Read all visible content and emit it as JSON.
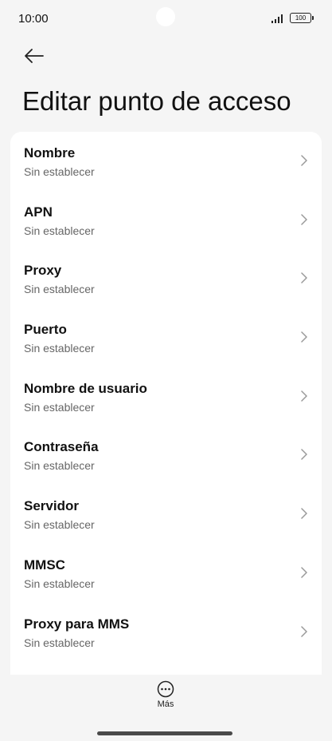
{
  "status_bar": {
    "time": "10:00",
    "battery": "100",
    "icons": [
      "signal-icon",
      "battery-icon"
    ]
  },
  "header": {
    "back_icon": "arrow-left-icon",
    "title": "Editar punto de acceso"
  },
  "settings": {
    "items": [
      {
        "label": "Nombre",
        "value": "Sin establecer"
      },
      {
        "label": "APN",
        "value": "Sin establecer"
      },
      {
        "label": "Proxy",
        "value": "Sin establecer"
      },
      {
        "label": "Puerto",
        "value": "Sin establecer"
      },
      {
        "label": "Nombre de usuario",
        "value": "Sin establecer"
      },
      {
        "label": "Contraseña",
        "value": "Sin establecer"
      },
      {
        "label": "Servidor",
        "value": "Sin establecer"
      },
      {
        "label": "MMSC",
        "value": "Sin establecer"
      },
      {
        "label": "Proxy para MMS",
        "value": "Sin establecer"
      }
    ]
  },
  "bottom_bar": {
    "more_label": "Más",
    "more_icon": "more-horizontal-icon"
  },
  "colors": {
    "background": "#f5f5f5",
    "card": "#ffffff",
    "text_primary": "#111111",
    "text_secondary": "#666666"
  }
}
